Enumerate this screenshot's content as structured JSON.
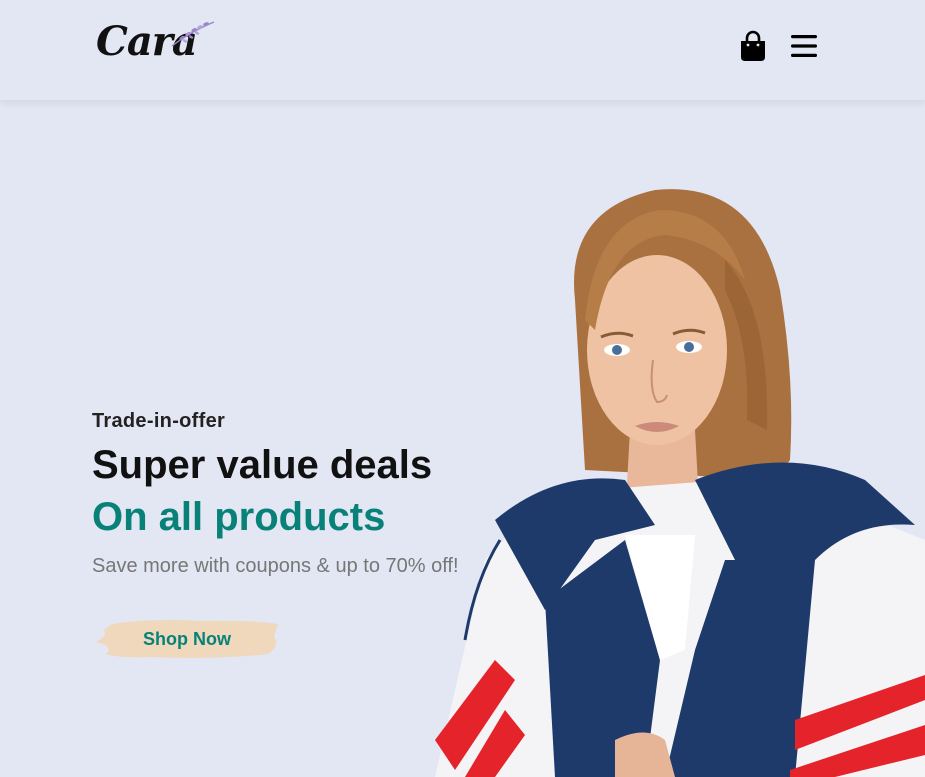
{
  "header": {
    "logo_text": "Cara",
    "bag_icon": "shopping-bag-icon",
    "menu_icon": "hamburger-menu-icon"
  },
  "hero": {
    "eyebrow": "Trade-in-offer",
    "headline": "Super value deals",
    "subheadline": "On all products",
    "description": "Save more with coupons & up to 70% off!",
    "button_label": "Shop Now",
    "image": "model-in-track-jacket-photo"
  },
  "colors": {
    "background": "#e3e6f3",
    "accent": "#088178",
    "button_bg": "#f0d8bc",
    "text_dark": "#111111",
    "text_muted": "#777777"
  }
}
